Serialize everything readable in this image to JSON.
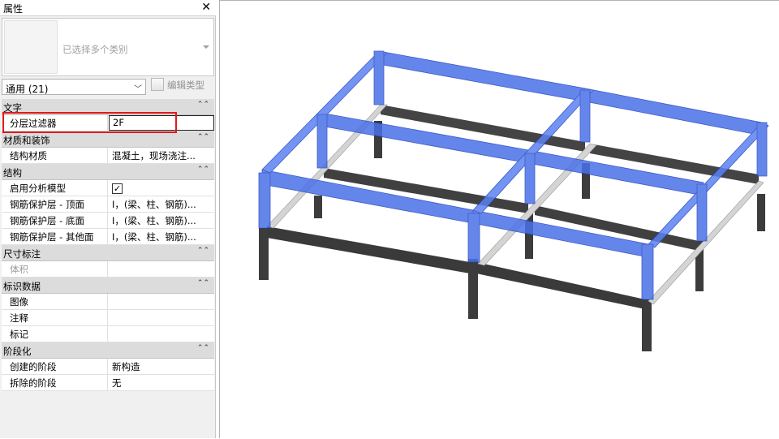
{
  "panel": {
    "title": "属性",
    "close_glyph": "✕",
    "type_selector": {
      "text": "已选择多个类别"
    },
    "filter": {
      "value": "通用 (21)"
    },
    "edit_type_label": "编辑类型",
    "categories": [
      {
        "name": "文字",
        "rows": [
          {
            "name": "分层过滤器",
            "value": "2F"
          }
        ]
      },
      {
        "name": "材质和装饰",
        "rows": [
          {
            "name": "结构材质",
            "value": "混凝土，现场浇注..."
          }
        ]
      },
      {
        "name": "结构",
        "rows": [
          {
            "name": "启用分析模型",
            "value": ""
          },
          {
            "name": "钢筋保护层 - 顶面",
            "value": "I，(梁、柱、钢筋)..."
          },
          {
            "name": "钢筋保护层 - 底面",
            "value": "I，(梁、柱、钢筋)..."
          },
          {
            "name": "钢筋保护层 - 其他面",
            "value": "I，(梁、柱、钢筋)..."
          }
        ]
      },
      {
        "name": "尺寸标注",
        "rows": [
          {
            "name": "体积",
            "value": ""
          }
        ]
      },
      {
        "name": "标识数据",
        "rows": [
          {
            "name": "图像",
            "value": ""
          },
          {
            "name": "注释",
            "value": ""
          },
          {
            "name": "标记",
            "value": ""
          }
        ]
      },
      {
        "name": "阶段化",
        "rows": [
          {
            "name": "创建的阶段",
            "value": "新构造"
          },
          {
            "name": "拆除的阶段",
            "value": "无"
          }
        ]
      }
    ],
    "analytical_model_checked": true
  },
  "colors": {
    "selection_blue": "#4a72e8",
    "selection_blue_dark": "#1f3fbf",
    "concrete_dark": "#3c3c3c",
    "concrete_light": "#d4d4d4",
    "highlight_red": "#e0191e"
  }
}
